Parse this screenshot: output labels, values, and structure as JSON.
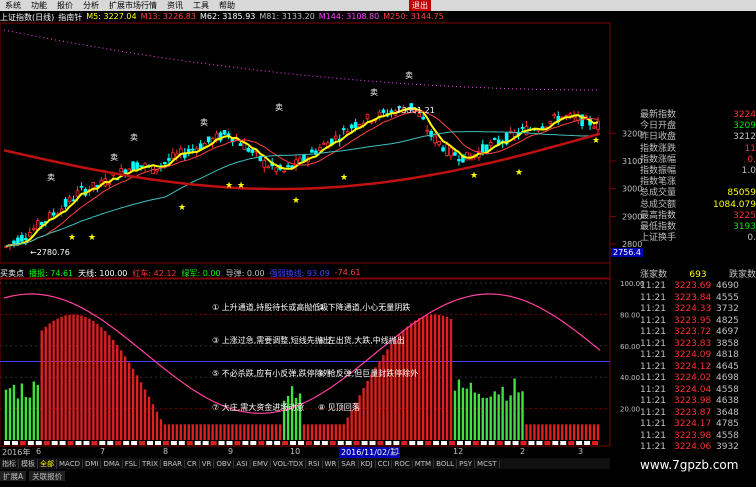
{
  "menu": [
    "系统",
    "功能",
    "报价",
    "分析",
    "扩展市场行情",
    "资讯",
    "工具",
    "帮助"
  ],
  "close_label": "退出",
  "header": {
    "title": "上证指数(日线)",
    "sub": "指南针",
    "ma": [
      {
        "label": "M5:",
        "value": "3227.04",
        "color": "#ffff00"
      },
      {
        "label": "M13:",
        "value": "3226.83",
        "color": "#ff4040"
      },
      {
        "label": "M62:",
        "value": "3185.93",
        "color": "#ffffff"
      },
      {
        "label": "M81:",
        "value": "3133.20",
        "color": "#c0c0c0"
      },
      {
        "label": "M144:",
        "value": "3108.80",
        "color": "#ff40ff"
      },
      {
        "label": "M250:",
        "value": "3144.75",
        "color": "#ff4040"
      }
    ]
  },
  "price_axis": [
    "3200",
    "3100",
    "3000",
    "2900",
    "2800"
  ],
  "price_box": "2756.4",
  "annotations_main": {
    "sell": "卖",
    "low": "2780.76",
    "high": "3301.21"
  },
  "right_panel": [
    {
      "label": "最新指数",
      "value": "3224",
      "cls": ""
    },
    {
      "label": "今日开盘",
      "value": "3209",
      "cls": "g"
    },
    {
      "label": "昨日收盘",
      "value": "3212",
      "cls": "w"
    },
    {
      "label": "指数涨跌",
      "value": "11",
      "cls": ""
    },
    {
      "label": "指数涨幅",
      "value": "0.",
      "cls": ""
    },
    {
      "label": "指数振幅",
      "value": "1.0",
      "cls": "w"
    },
    {
      "label": "指数笔涨",
      "value": "",
      "cls": ""
    },
    {
      "label": "总成交量",
      "value": "85059",
      "cls": "y"
    },
    {
      "label": "总成交额",
      "value": "1084.079",
      "cls": "y"
    },
    {
      "label": "最高指数",
      "value": "3225",
      "cls": ""
    },
    {
      "label": "最低指数",
      "value": "3193",
      "cls": "g"
    },
    {
      "label": "上证换手",
      "value": "0.",
      "cls": "w"
    }
  ],
  "trades": {
    "rise_label": "涨家数",
    "rise": "693",
    "fall_label": "跌家数",
    "rows": [
      {
        "t": "11:21",
        "p": "3223.69",
        "v": "4690"
      },
      {
        "t": "11:21",
        "p": "3223.84",
        "v": "4555"
      },
      {
        "t": "11:21",
        "p": "3224.33",
        "v": "3732"
      },
      {
        "t": "11:21",
        "p": "3223.95",
        "v": "4825"
      },
      {
        "t": "11:21",
        "p": "3223.72",
        "v": "4697"
      },
      {
        "t": "11:21",
        "p": "3223.83",
        "v": "3858"
      },
      {
        "t": "11:21",
        "p": "3224.09",
        "v": "4818"
      },
      {
        "t": "11:21",
        "p": "3224.12",
        "v": "4645"
      },
      {
        "t": "11:21",
        "p": "3224.02",
        "v": "4698"
      },
      {
        "t": "11:21",
        "p": "3224.04",
        "v": "4558"
      },
      {
        "t": "11:21",
        "p": "3223.98",
        "v": "4638"
      },
      {
        "t": "11:21",
        "p": "3223.87",
        "v": "3648"
      },
      {
        "t": "11:21",
        "p": "3224.17",
        "v": "4785"
      },
      {
        "t": "11:21",
        "p": "3223.98",
        "v": "4558"
      },
      {
        "t": "11:21",
        "p": "3224.06",
        "v": "3932"
      }
    ]
  },
  "sub": {
    "name": "买卖点",
    "items": [
      {
        "label": "播报:",
        "value": "74.61",
        "color": "#00ff00"
      },
      {
        "label": "天线:",
        "value": "100.00",
        "color": "#ffffff"
      },
      {
        "label": "红车:",
        "value": "42.12",
        "color": "#ff3030"
      },
      {
        "label": "绿军:",
        "value": "0.00",
        "color": "#00ff00"
      },
      {
        "label": "导弹:",
        "value": "0.00",
        "color": "#c0c0c0"
      },
      {
        "label": "强弱换线:",
        "value": "93.09",
        "color": "#4040ff"
      },
      {
        "label": "",
        "value": "-74.61",
        "color": "#ff4040"
      }
    ],
    "axis": [
      "100.00",
      "80.00",
      "60.00",
      "40.00",
      "20.00"
    ],
    "notes": [
      "① 上升通道,持股待长或高抛低吸",
      "② 下降通道,小心无量阴跌",
      "③ 上涨过急,需要调整,短线先抛出",
      "④ 左出货,大跌,中线抛出",
      "⑤ 不必杀跌,应有小反弹,跌停除外",
      "⑥ 抢反弹,但巨量封跌停除外",
      "⑦ 大庄,需大资金进场动意",
      "⑧ 见顶回落"
    ]
  },
  "dates": {
    "left": "2016年",
    "mark": "2016/11/02/三",
    "ticks": [
      "6",
      "7",
      "8",
      "9",
      "10",
      "11",
      "12",
      "2",
      "3"
    ]
  },
  "index_tabs": [
    "指标",
    "模板",
    "全部",
    "MACD",
    "DMI",
    "DMA",
    "FSL",
    "TRIX",
    "BRAR",
    "CR",
    "VR",
    "OBV",
    "ASI",
    "EMV",
    "VOL-TDX",
    "RSI",
    "WR",
    "SAR",
    "KDJ",
    "CCI",
    "ROC",
    "MTM",
    "BOLL",
    "PSY",
    "MCST"
  ],
  "bottom_tabs": [
    "扩展A",
    "关联报价"
  ],
  "watermark": "www.7gpzb.com",
  "colors": {
    "up": "#ff3030",
    "down": "#00ffff",
    "ma5": "#ffff00",
    "ma13": "#ff4040",
    "bg": "#000000"
  },
  "chart_data": {
    "type": "line",
    "title": "上证指数(日线)",
    "ylabel": "",
    "ylim": [
      2750,
      3320
    ],
    "series": [
      {
        "name": "M5",
        "values": [
          2790,
          2830,
          2880,
          2930,
          2990,
          3010,
          3050,
          3090,
          3070,
          3110,
          3140,
          3170,
          3200,
          3150,
          3090,
          3060,
          3100,
          3150,
          3190,
          3240,
          3260,
          3280,
          3300,
          3190,
          3130,
          3110,
          3150,
          3180,
          3210,
          3230,
          3260,
          3250,
          3230
        ]
      }
    ]
  }
}
